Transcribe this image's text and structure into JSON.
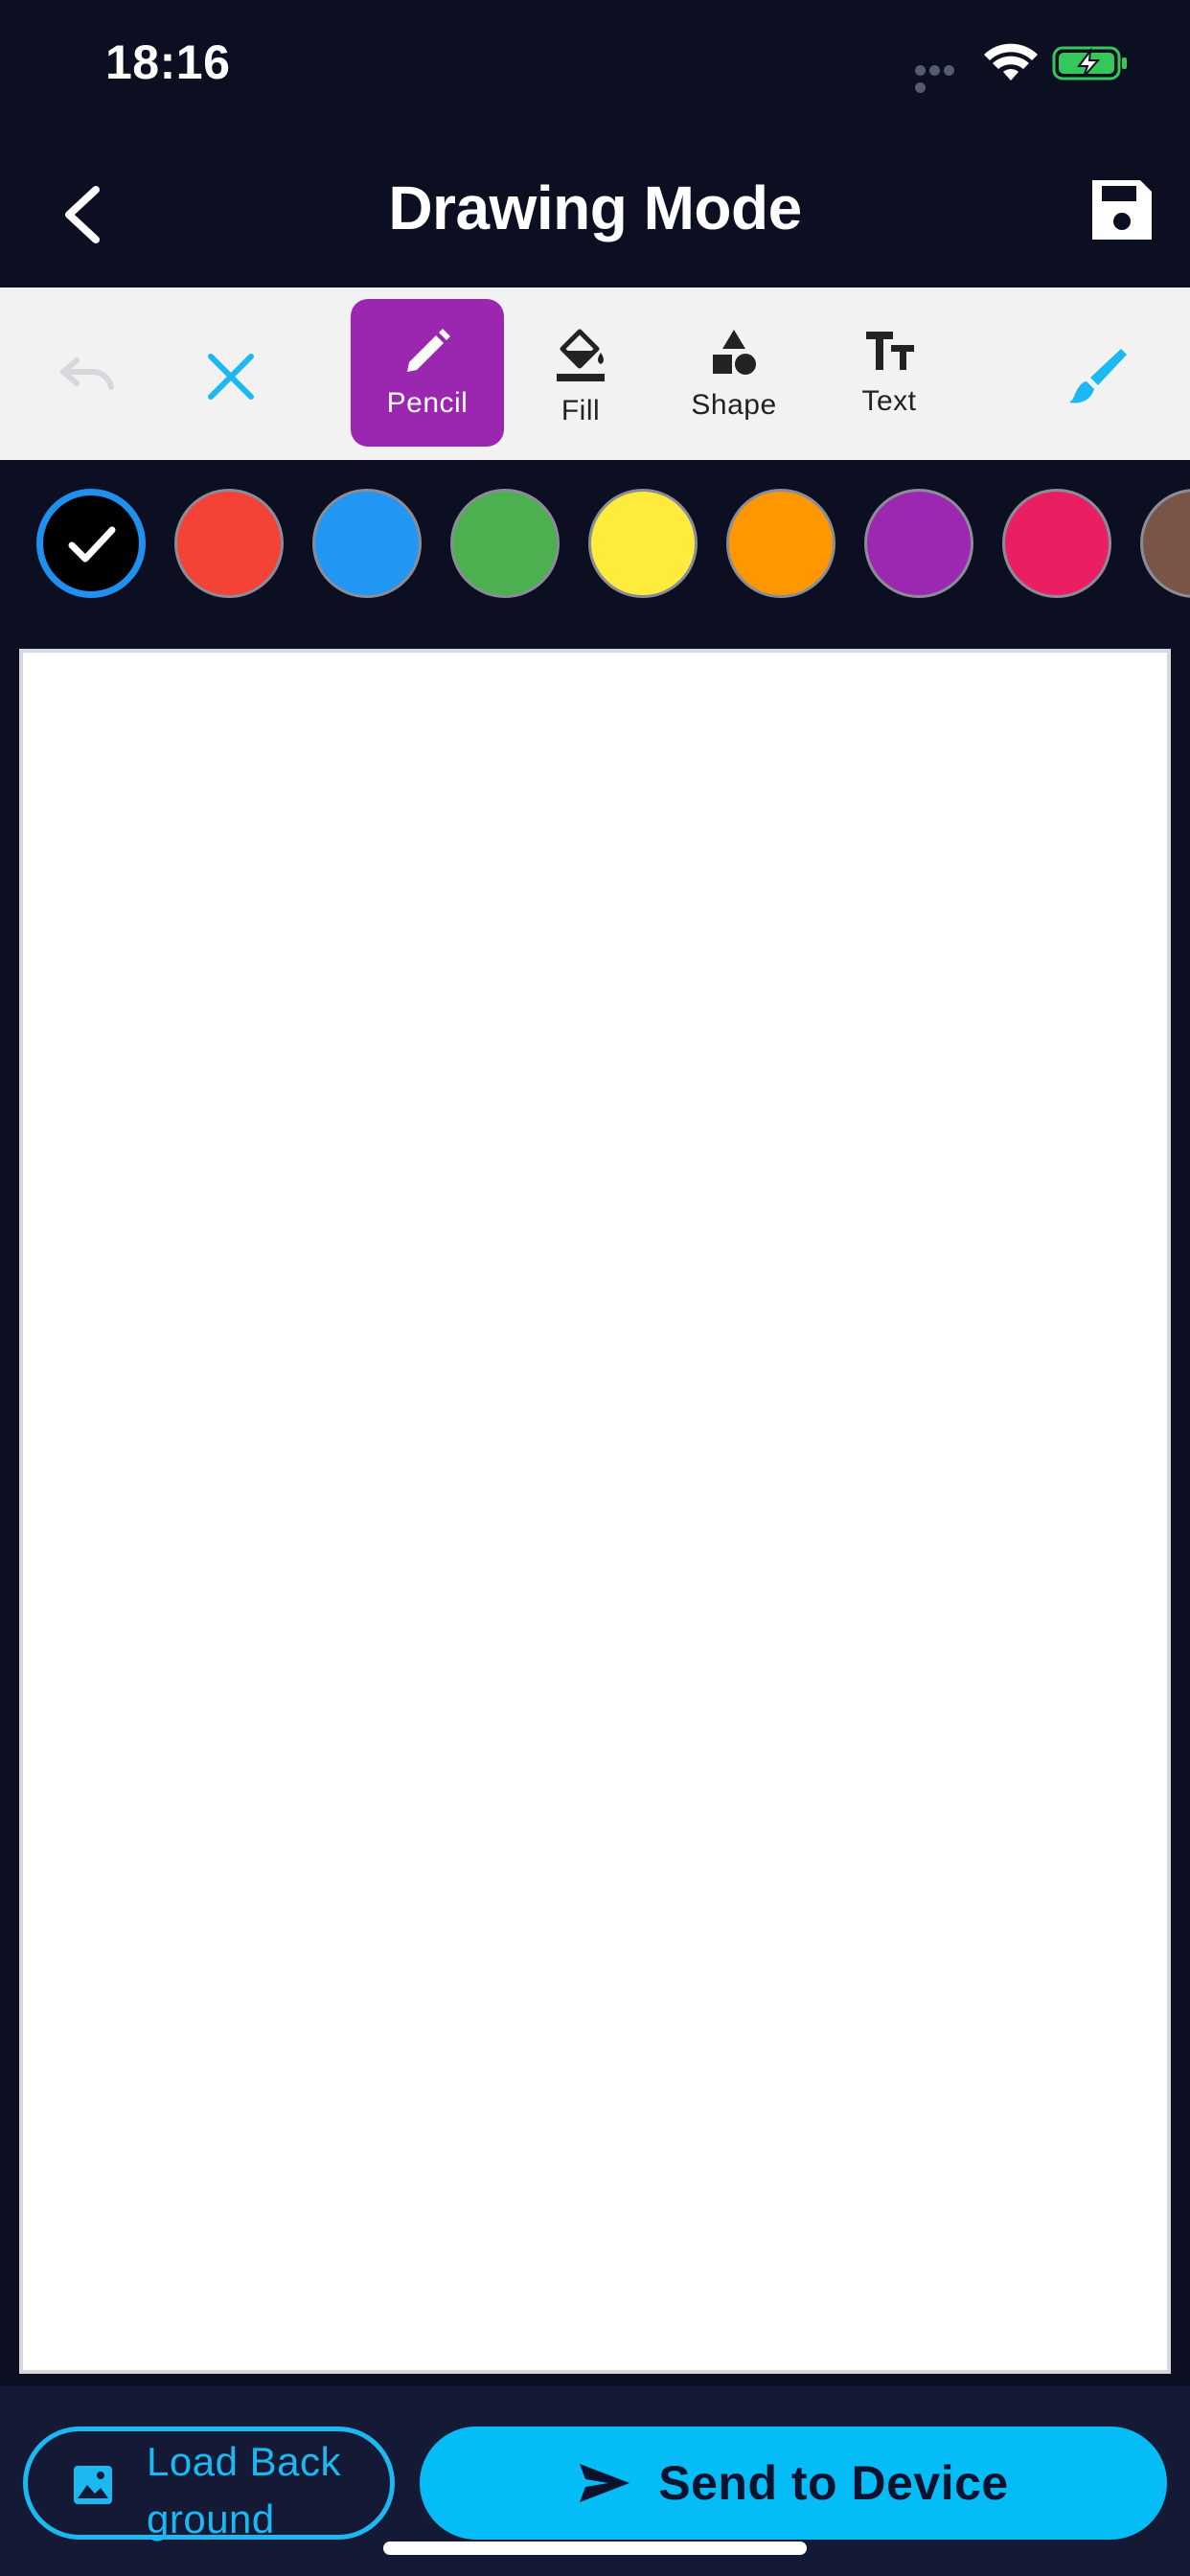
{
  "status_bar": {
    "time": "18:16",
    "icons": [
      "signal-dots-icon",
      "wifi-icon",
      "battery-charging-icon"
    ],
    "battery_color": "#34c759"
  },
  "header": {
    "title": "Drawing Mode",
    "back_icon": "chevron-left-icon",
    "save_icon": "save-icon"
  },
  "toolbar": {
    "undo_icon": "undo-icon",
    "clear_icon": "close-icon",
    "tools": [
      {
        "label": "Pencil",
        "icon": "pencil-icon",
        "active": true
      },
      {
        "label": "Fill",
        "icon": "paint-bucket-icon",
        "active": false
      },
      {
        "label": "Shape",
        "icon": "shapes-icon",
        "active": false
      },
      {
        "label": "Text",
        "icon": "text-size-icon",
        "active": false
      }
    ],
    "brush_icon": "brush-icon",
    "active_color": "#9b27b0",
    "accent_color": "#1cb8f2"
  },
  "palette": {
    "colors": [
      "#000000",
      "#f44336",
      "#2196f3",
      "#4caf50",
      "#ffeb3b",
      "#ff9800",
      "#9c27b0",
      "#e91e63",
      "#795548"
    ],
    "selected_index": 0
  },
  "bottom_bar": {
    "load_background_label": "Load Background",
    "send_label": "Send to Device",
    "send_color": "#05bdf6"
  }
}
